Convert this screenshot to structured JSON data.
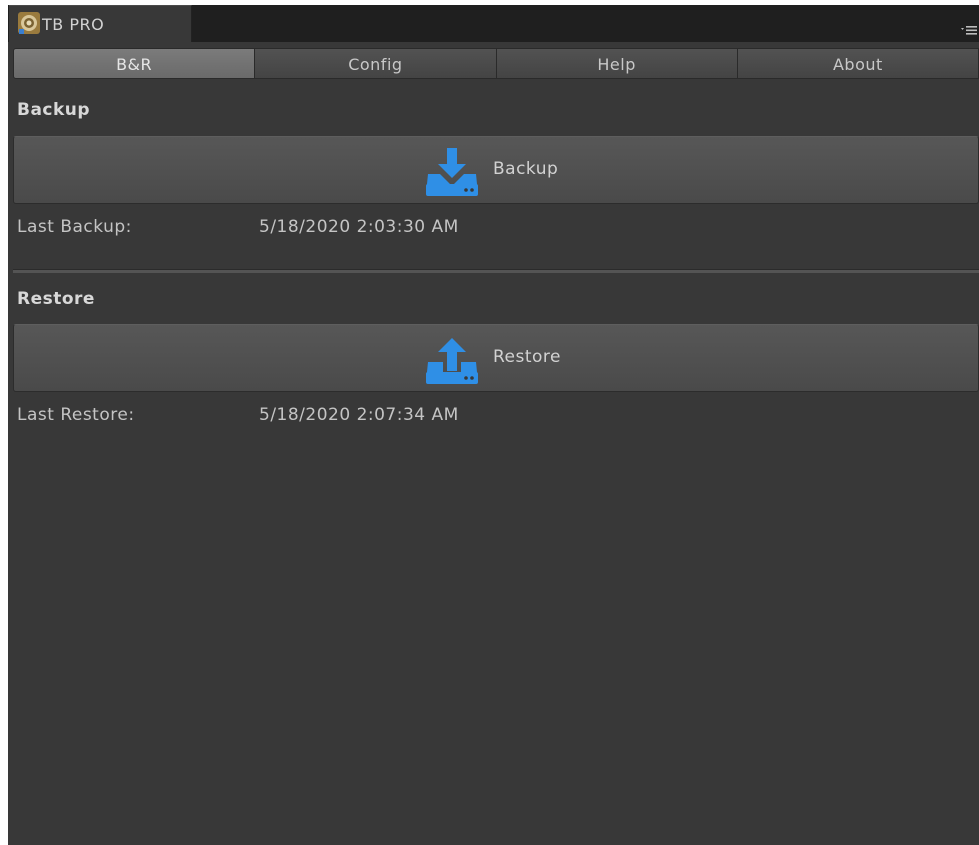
{
  "window": {
    "tab_title": "TB PRO",
    "tab_icon": "app-logo-icon",
    "menu_icon": "window-menu-icon"
  },
  "toolbar": {
    "tabs": [
      {
        "label": "B&R",
        "active": true
      },
      {
        "label": "Config",
        "active": false
      },
      {
        "label": "Help",
        "active": false
      },
      {
        "label": "About",
        "active": false
      }
    ]
  },
  "backup": {
    "heading": "Backup",
    "button_label": "Backup",
    "button_icon": "download-drive-icon",
    "last_label": "Last Backup:",
    "last_value": "5/18/2020 2:03:30 AM"
  },
  "restore": {
    "heading": "Restore",
    "button_label": "Restore",
    "button_icon": "upload-drive-icon",
    "last_label": "Last Restore:",
    "last_value": "5/18/2020 2:07:34 AM"
  },
  "colors": {
    "accent": "#2f8fe6",
    "background": "#383838",
    "titlebar": "#1f1f1f",
    "active_tab": "#727272"
  }
}
